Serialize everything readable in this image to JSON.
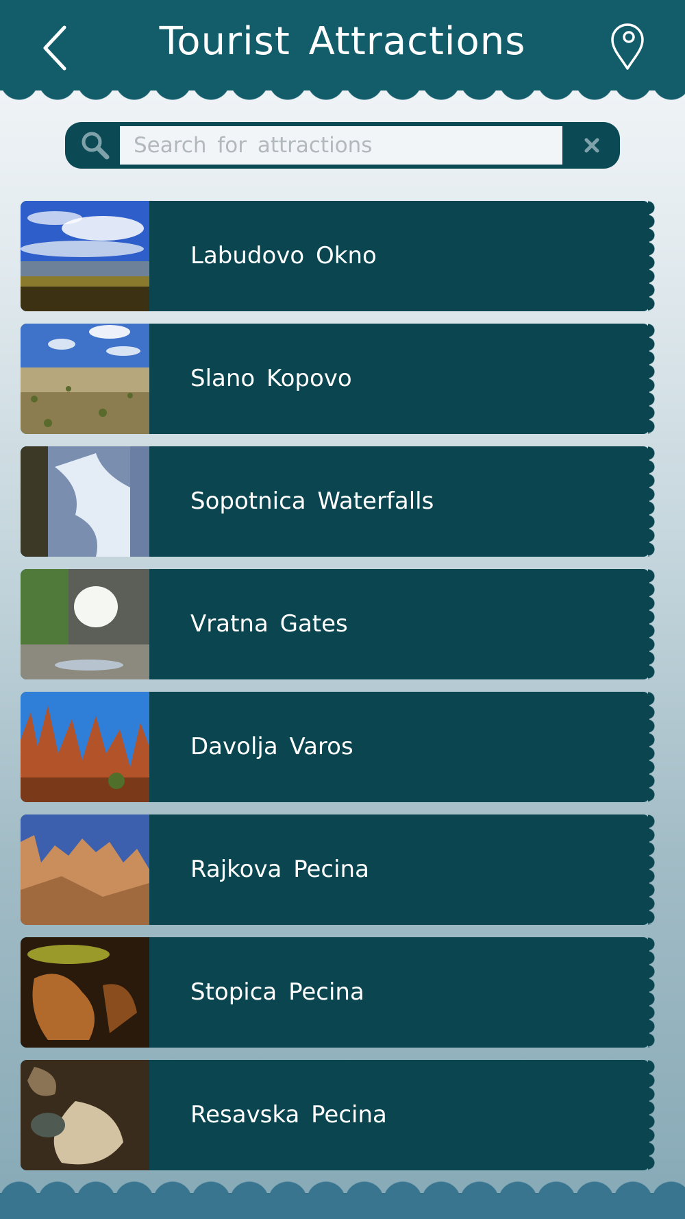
{
  "header": {
    "title": "Tourist Attractions",
    "back_icon": "chevron-left-icon",
    "map_icon": "map-pin-icon"
  },
  "search": {
    "placeholder": "Search for attractions",
    "value": "",
    "search_icon": "magnifier-icon",
    "clear_icon": "close-icon"
  },
  "attractions": [
    {
      "name": "Labudovo Okno",
      "thumbnail": "lake-landscape"
    },
    {
      "name": "Slano Kopovo",
      "thumbnail": "grass-steppe"
    },
    {
      "name": "Sopotnica Waterfalls",
      "thumbnail": "waterfall"
    },
    {
      "name": "Vratna Gates",
      "thumbnail": "rock-arch"
    },
    {
      "name": "Davolja Varos",
      "thumbnail": "rock-pillars"
    },
    {
      "name": "Rajkova Pecina",
      "thumbnail": "sandstone-spires"
    },
    {
      "name": "Stopica Pecina",
      "thumbnail": "cave-formations"
    },
    {
      "name": "Resavska Pecina",
      "thumbnail": "cave-pools"
    }
  ],
  "colors": {
    "header": "#135d6b",
    "item_background": "#0b4650",
    "footer": "#3a7590"
  }
}
